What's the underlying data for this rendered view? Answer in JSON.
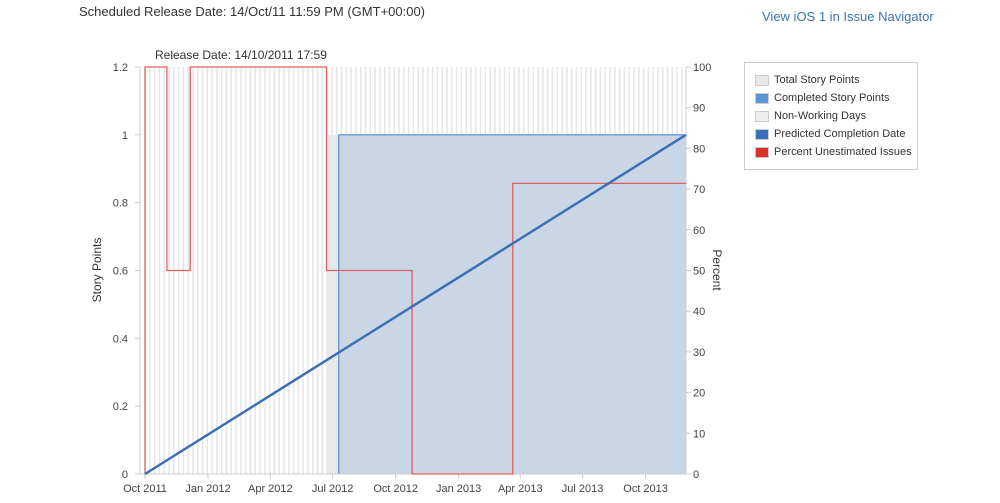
{
  "header": {
    "scheduled": "Scheduled Release Date: 14/Oct/11 11:59 PM (GMT+00:00)",
    "nav_link": "View iOS 1 in Issue Navigator"
  },
  "chart_data": {
    "type": "area",
    "title": "Release Date: 14/10/2011 17:59",
    "ylabel": "Story Points",
    "y2label": "Percent",
    "ylim": [
      0,
      1.2
    ],
    "y2lim": [
      0,
      100
    ],
    "xlim": [
      "2011-10-01",
      "2013-11-29"
    ],
    "yticks": [
      "0",
      "0.2",
      "0.4",
      "0.6",
      "0.8",
      "1",
      "1.2"
    ],
    "y2ticks": [
      "0",
      "10",
      "20",
      "30",
      "40",
      "50",
      "60",
      "70",
      "80",
      "90",
      "100"
    ],
    "xticks": [
      {
        "date": "2011-10-01",
        "label": "Oct 2011"
      },
      {
        "date": "2012-01-01",
        "label": "Jan 2012"
      },
      {
        "date": "2012-04-01",
        "label": "Apr 2012"
      },
      {
        "date": "2012-07-01",
        "label": "Jul 2012"
      },
      {
        "date": "2012-10-01",
        "label": "Oct 2012"
      },
      {
        "date": "2013-01-01",
        "label": "Jan 2013"
      },
      {
        "date": "2013-04-01",
        "label": "Apr 2013"
      },
      {
        "date": "2013-07-01",
        "label": "Jul 2013"
      },
      {
        "date": "2013-10-01",
        "label": "Oct 2013"
      }
    ],
    "legend_position": "right",
    "series": [
      {
        "name": "Total Story Points",
        "color": "#e8e8e8",
        "type": "step-area",
        "points": [
          [
            "2012-06-22",
            1
          ],
          [
            "2013-11-29",
            1
          ]
        ]
      },
      {
        "name": "Completed Story Points",
        "color": "#3b7fcf",
        "type": "step-area",
        "points": [
          [
            "2012-07-10",
            1
          ],
          [
            "2013-11-29",
            1
          ]
        ]
      },
      {
        "name": "Non-Working Days",
        "color": "#eeeeee",
        "type": "bands"
      },
      {
        "name": "Predicted Completion Date",
        "color": "#3a6fb5",
        "type": "line",
        "points": [
          [
            "2011-10-01",
            0
          ],
          [
            "2013-11-29",
            1
          ]
        ]
      },
      {
        "name": "Percent Unestimated Issues",
        "color": "#d9312b",
        "type": "step",
        "axis": "right",
        "points": [
          [
            "2011-10-01",
            100
          ],
          [
            "2011-11-02",
            50
          ],
          [
            "2011-12-06",
            100
          ],
          [
            "2012-06-22",
            50
          ],
          [
            "2012-10-25",
            0
          ],
          [
            "2013-03-21",
            71.4
          ],
          [
            "2013-11-29",
            71.4
          ]
        ]
      }
    ]
  }
}
